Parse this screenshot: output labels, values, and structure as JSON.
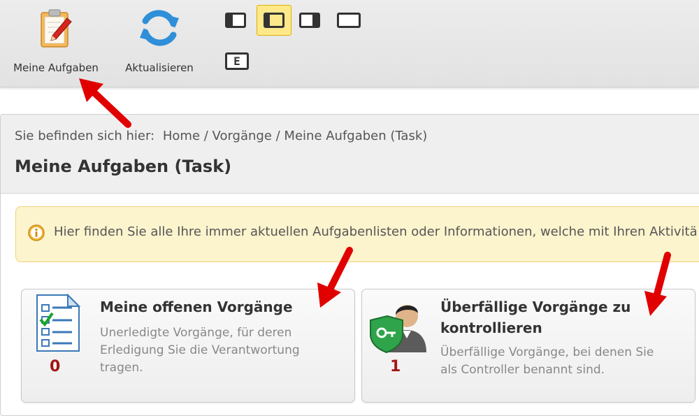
{
  "toolbar": {
    "my_tasks_label": "Meine Aufgaben",
    "refresh_label": "Aktualisieren",
    "e_label": "E"
  },
  "breadcrumb": {
    "prefix": "Sie befinden sich hier:",
    "path": "Home / Vorgänge / Meine Aufgaben (Task)"
  },
  "page_title": "Meine Aufgaben (Task)",
  "info": {
    "text": "Hier finden Sie alle Ihre immer aktuellen Aufgabenlisten oder Informationen, welche mit Ihren Aktivitä"
  },
  "cards": [
    {
      "title": "Meine offenen Vorgänge",
      "description_lines": [
        "Unerledigte Vorgänge, für deren",
        "Erledigung Sie die Verantwortung",
        "tragen."
      ],
      "count": "0",
      "icon": "checklist-icon"
    },
    {
      "title_lines": [
        "Überfällige Vorgänge zu",
        "kontrollieren"
      ],
      "description_lines": [
        "Überfällige Vorgänge, bei denen Sie",
        "als Controller benannt sind."
      ],
      "count": "1",
      "icon": "controller-icon"
    }
  ],
  "colors": {
    "accent_count": "#a31515",
    "info_background": "#fcf4cd",
    "arrow": "#e00000",
    "active_layout": "#fde98a"
  }
}
